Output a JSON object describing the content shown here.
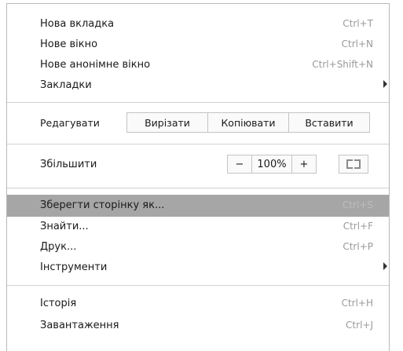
{
  "menu": {
    "group1": [
      {
        "label": "Нова вкладка",
        "shortcut": "Ctrl+T"
      },
      {
        "label": "Нове вікно",
        "shortcut": "Ctrl+N"
      },
      {
        "label": "Нове анонімне вікно",
        "shortcut": "Ctrl+Shift+N"
      },
      {
        "label": "Закладки",
        "shortcut": "",
        "submenu": true
      }
    ],
    "edit": {
      "label": "Редагувати",
      "cut": "Вирізати",
      "copy": "Копіювати",
      "paste": "Вставити"
    },
    "zoom": {
      "label": "Збільшити",
      "minus": "−",
      "value": "100%",
      "plus": "+",
      "fullscreen_icon": "fullscreen-icon"
    },
    "group2": [
      {
        "label": "Зберегти сторінку як...",
        "shortcut": "Ctrl+S",
        "highlighted": true
      },
      {
        "label": "Знайти...",
        "shortcut": "Ctrl+F"
      },
      {
        "label": "Друк...",
        "shortcut": "Ctrl+P"
      },
      {
        "label": "Інструменти",
        "shortcut": "",
        "submenu": true
      }
    ],
    "group3": [
      {
        "label": "Історія",
        "shortcut": "Ctrl+H"
      },
      {
        "label": "Завантаження",
        "shortcut": "Ctrl+J"
      }
    ]
  },
  "colors": {
    "highlight": "#a6a6a6",
    "shortcut": "#9a9a9a",
    "border": "#b8b8b8"
  }
}
